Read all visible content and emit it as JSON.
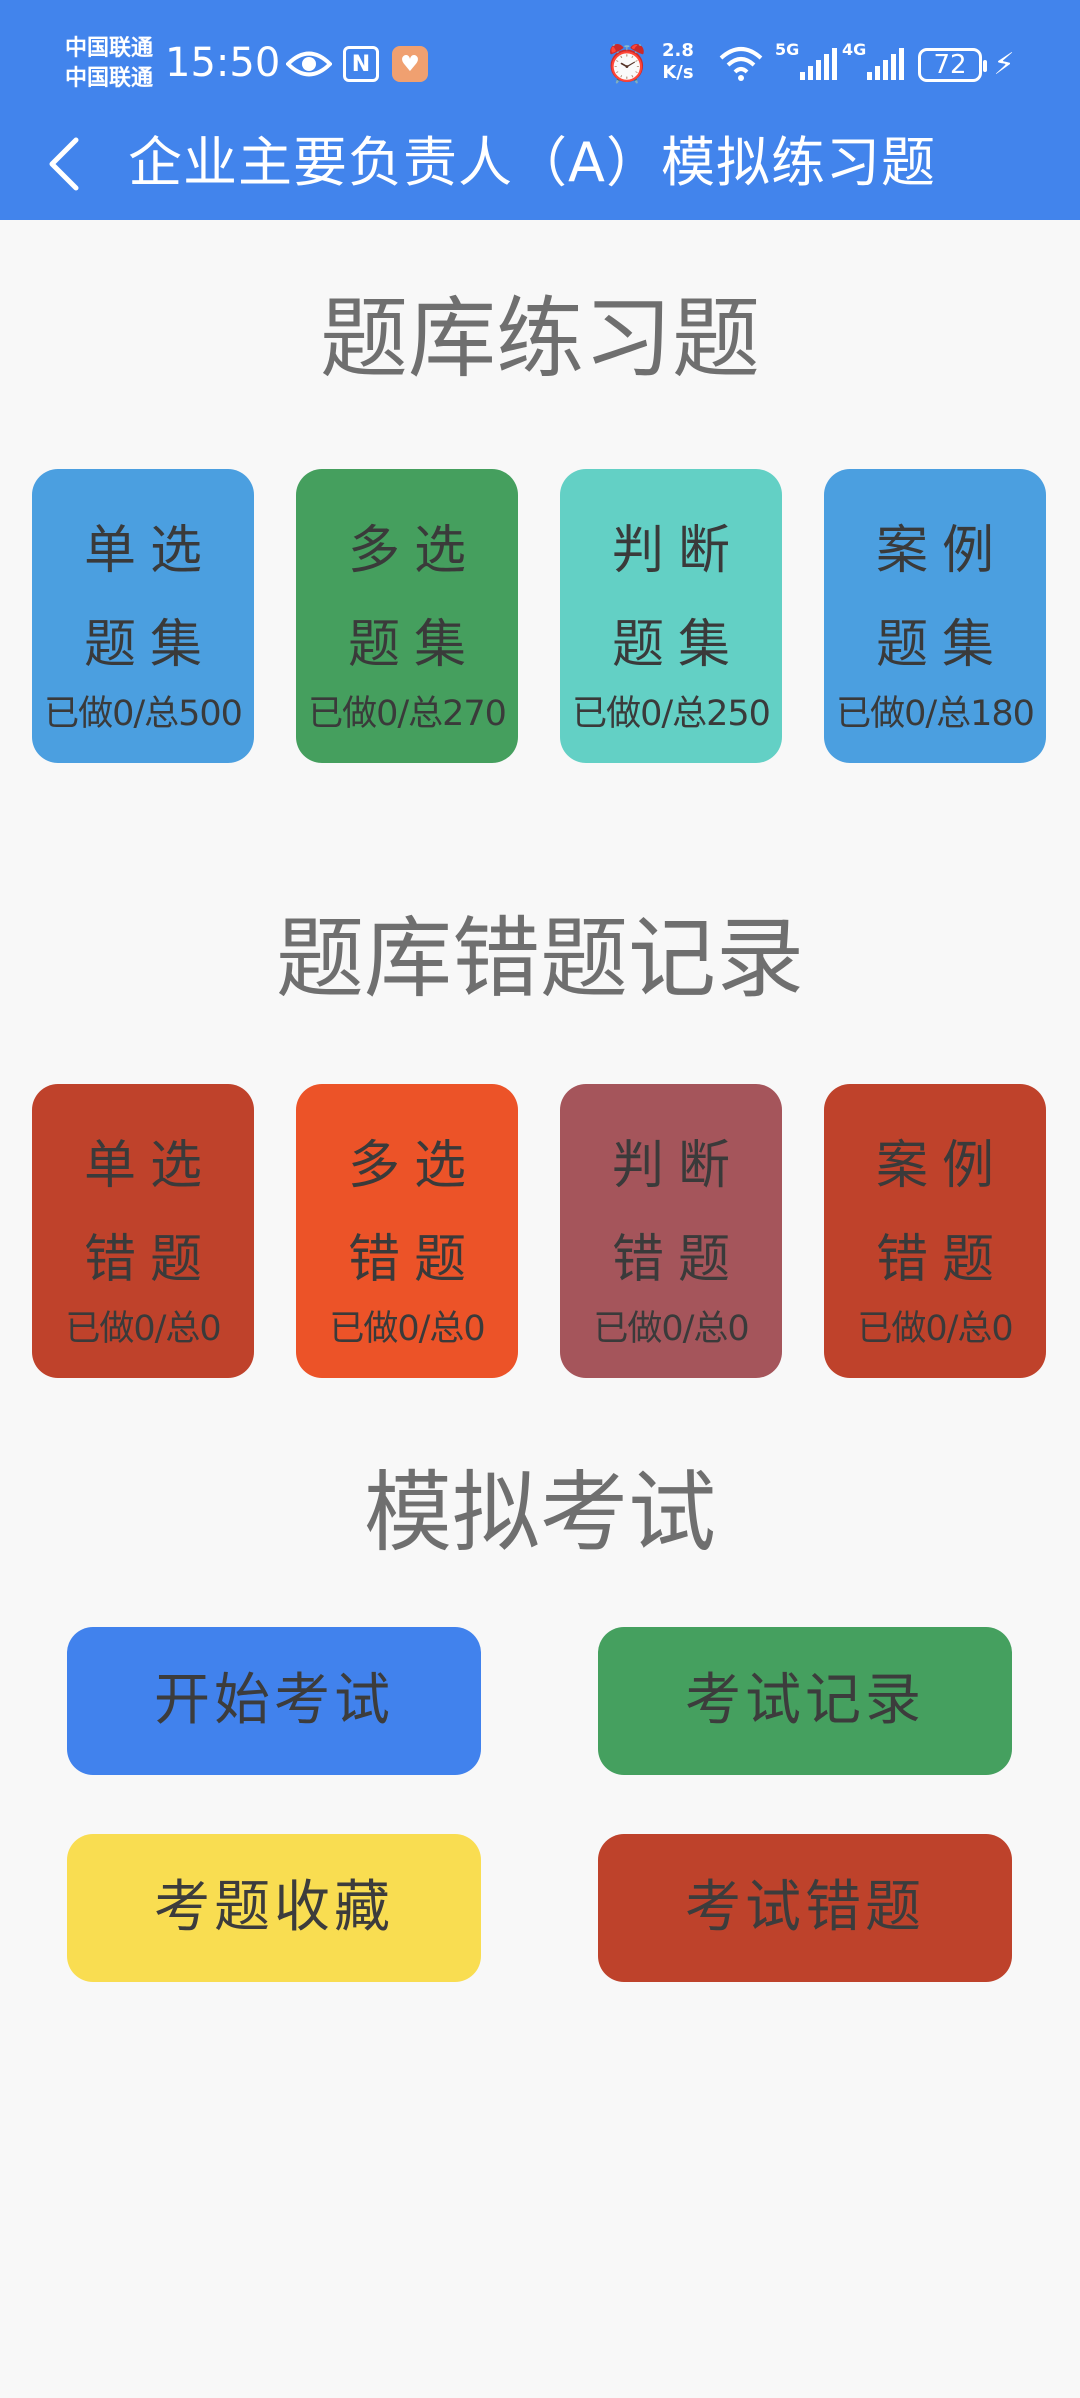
{
  "status_bar": {
    "carrier_1": "中国联通",
    "carrier_2": "中国联通",
    "time": "15:50",
    "net_speed_value": "2.8",
    "net_speed_unit": "K/s",
    "signal_1": "5G",
    "signal_2": "4G",
    "battery": "72",
    "icons": [
      "eye-icon",
      "nfc-icon",
      "app-notification-icon",
      "alarm-icon",
      "wifi-icon",
      "charging-icon"
    ]
  },
  "header": {
    "title": "企业主要负责人（A）模拟练习题",
    "back_icon": "chevron-left-icon",
    "color": "#4284ec"
  },
  "practice": {
    "title": "题库练习题",
    "cards": [
      {
        "line1": "单选",
        "line2": "题集",
        "count": "已做0/总500",
        "color": "#4b9fe0"
      },
      {
        "line1": "多选",
        "line2": "题集",
        "count": "已做0/总270",
        "color": "#459f5e"
      },
      {
        "line1": "判断",
        "line2": "题集",
        "count": "已做0/总250",
        "color": "#63d0c5"
      },
      {
        "line1": "案例",
        "line2": "题集",
        "count": "已做0/总180",
        "color": "#4b9fe0"
      }
    ]
  },
  "mistakes": {
    "title": "题库错题记录",
    "cards": [
      {
        "line1": "单选",
        "line2": "错题",
        "count": "已做0/总0",
        "color": "#bf422b"
      },
      {
        "line1": "多选",
        "line2": "错题",
        "count": "已做0/总0",
        "color": "#ec5328"
      },
      {
        "line1": "判断",
        "line2": "错题",
        "count": "已做0/总0",
        "color": "#a5555b"
      },
      {
        "line1": "案例",
        "line2": "错题",
        "count": "已做0/总0",
        "color": "#bf422b"
      }
    ]
  },
  "exam": {
    "title": "模拟考试",
    "buttons": [
      {
        "label": "开始考试",
        "color": "#4182ed"
      },
      {
        "label": "考试记录",
        "color": "#45a05f"
      },
      {
        "label": "考题收藏",
        "color": "#f9dd51"
      },
      {
        "label": "考试错题",
        "color": "#be422b"
      }
    ]
  }
}
